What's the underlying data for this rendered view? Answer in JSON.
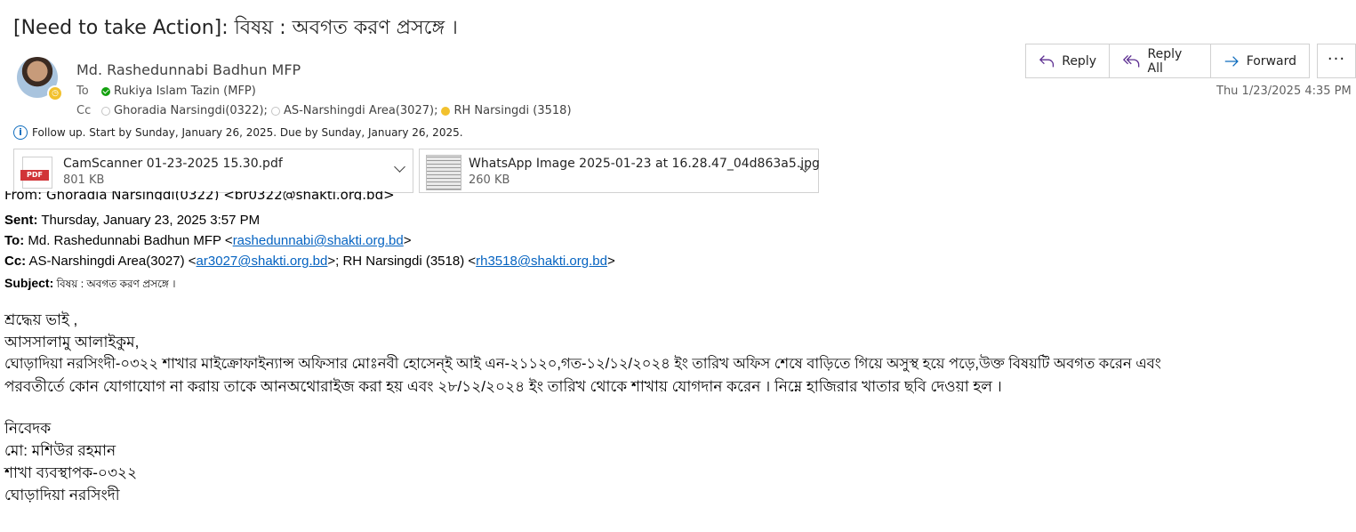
{
  "subject": "[Need to take Action]: বিষয় : অবগত করণ প্রসঙ্গে ।",
  "sender": {
    "name": "Md. Rashedunnabi Badhun MFP"
  },
  "to": {
    "label": "To",
    "recipients": [
      "Rukiya Islam Tazin (MFP)"
    ]
  },
  "cc": {
    "label": "Cc",
    "recipients": [
      "Ghoradia Narsingdi(0322);",
      "AS-Narshingdi Area(3027);",
      "RH Narsingdi (3518)"
    ]
  },
  "followup": "Follow up.  Start by Sunday, January 26, 2025.  Due by Sunday, January 26, 2025.",
  "attachments": [
    {
      "name": "CamScanner 01-23-2025 15.30.pdf",
      "size": "801 KB",
      "type": "PDF"
    },
    {
      "name": "WhatsApp Image 2025-01-23 at 16.28.47_04d863a5.jpg",
      "size": "260 KB",
      "type": "image"
    }
  ],
  "actions": {
    "reply": "Reply",
    "reply_all": "Reply All",
    "forward": "Forward",
    "more": "···"
  },
  "datetime": "Thu 1/23/2025 4:35 PM",
  "quoted": {
    "from_clipped": "From: Ghoradia Narsingdi(0322) <br0322@shakti.org.bd>",
    "sent_label": "Sent:",
    "sent_value": " Thursday, January 23, 2025 3:57 PM",
    "to_label": "To:",
    "to_name": " Md. Rashedunnabi Badhun MFP <",
    "to_email": "rashedunnabi@shakti.org.bd",
    "to_close": ">",
    "cc_label": "Cc:",
    "cc_name1": " AS-Narshingdi Area(3027) <",
    "cc_email1": "ar3027@shakti.org.bd",
    "cc_mid": ">; RH Narsingdi (3518) <",
    "cc_email2": "rh3518@shakti.org.bd",
    "cc_close": ">",
    "subject_label": "Subject:",
    "subject_value": " বিষয় : অবগত করণ প্রসঙ্গে ।"
  },
  "body": {
    "greeting": "শ্রদ্ধেয় ভাই ,",
    "salam": "আসসালামু আলাইকুম,",
    "para1": "ঘোড়াদিয়া নরসিংদী-০৩২২ শাখার মাইক্রোফাইন্যান্স অফিসার মোঃনবী হোসেন্ই আই এন-২১১২০,গত-১২/১২/২০২৪ ইং তারিখ অফিস শেষে বাড়িতে গিয়ে অসুস্থ হয়ে পড়ে,উক্ত বিষয়টি অবগত করেন এবং",
    "para2": "পরবতীর্তে কোন যোগাযোগ না করায় তাকে আনঅথোরাইজ করা হয় এবং ২৮/১২/২০২৪ ইং তারিখ থোকে শাখায় যোগদান করেন । নিম্নে হাজিরার খাতার ছবি দেওয়া হল ।",
    "sig1": "নিবেদক",
    "sig2": "মো: মশিউর রহমান",
    "sig3": "শাখা ব্যবস্থাপক-০৩২২",
    "sig4": "ঘোড়াদিয়া নরসিংদী"
  }
}
